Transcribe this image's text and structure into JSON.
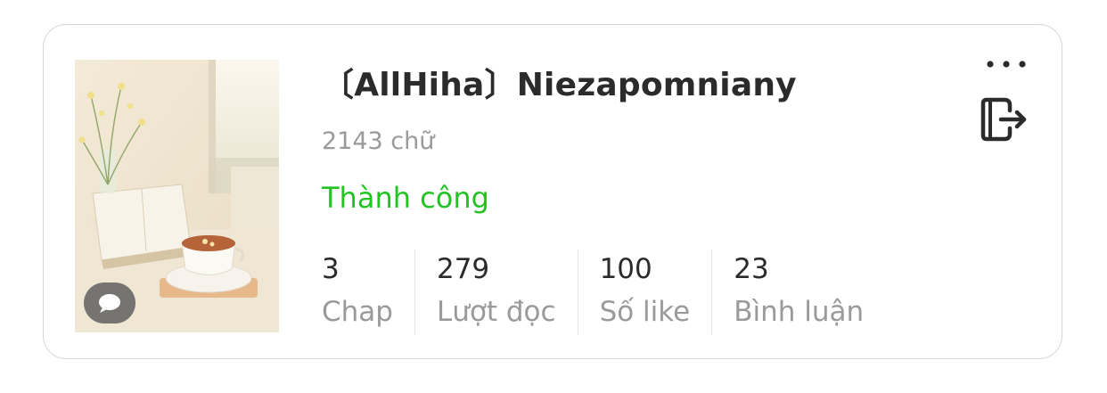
{
  "story": {
    "title": "〔AllHiha〕Niezapomniany",
    "word_count": "2143 chữ",
    "status": "Thành công",
    "status_color": "#22c322"
  },
  "stats": [
    {
      "value": "3",
      "label": "Chap"
    },
    {
      "value": "279",
      "label": "Lượt đọc"
    },
    {
      "value": "100",
      "label": "Số like"
    },
    {
      "value": "23",
      "label": "Bình luận"
    }
  ],
  "icons": {
    "more": "more-dots-icon",
    "exit": "exit-icon",
    "comment": "comment-bubble-icon"
  }
}
